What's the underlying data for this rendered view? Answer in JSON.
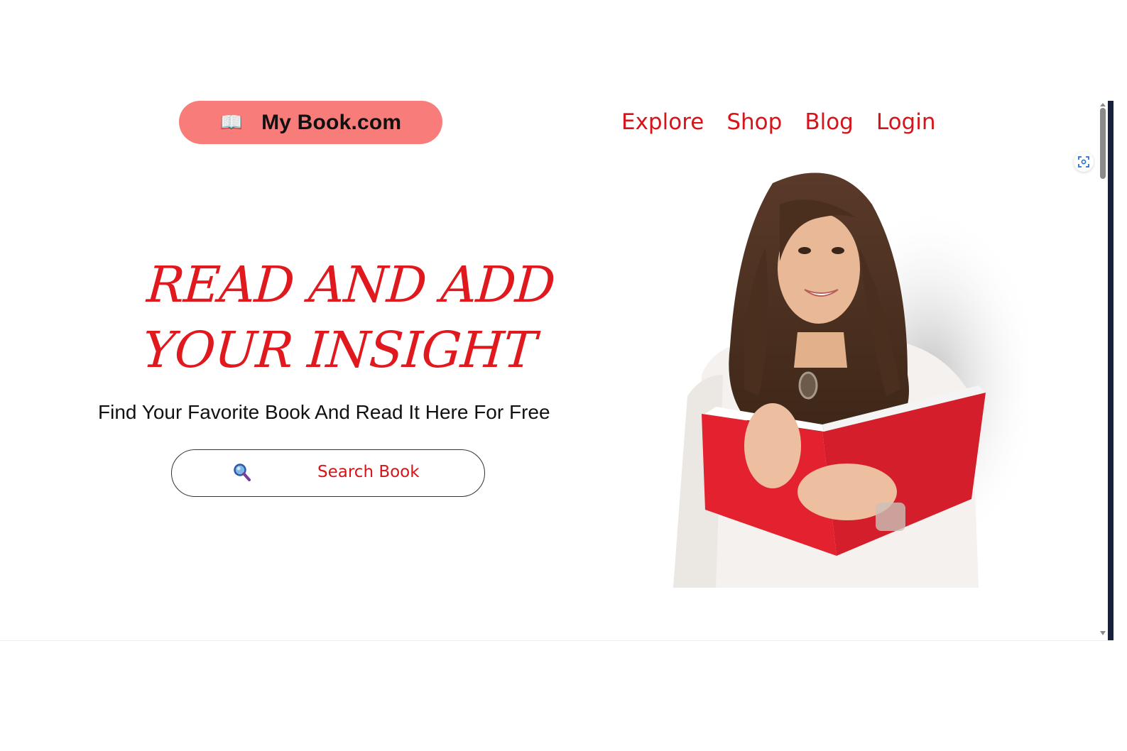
{
  "header": {
    "logo_icon": "open-book-emoji",
    "logo_emoji": "📖",
    "brand": "My Book.com",
    "nav": [
      "Explore",
      "Shop",
      "Blog",
      "Login"
    ]
  },
  "hero": {
    "headline_line1": "READ AND ADD",
    "headline_line2": "YOUR INSIGHT",
    "subtitle": "Find Your Favorite Book And Read It Here For Free",
    "search_icon": "magnifying-glass-icon",
    "search_label": "Search Book",
    "image_description_icon": "woman-reading-red-book-photo"
  },
  "colors": {
    "accent_red": "#d61419",
    "logo_pill": "#f87d7a",
    "scroll_edge": "#17213a"
  }
}
